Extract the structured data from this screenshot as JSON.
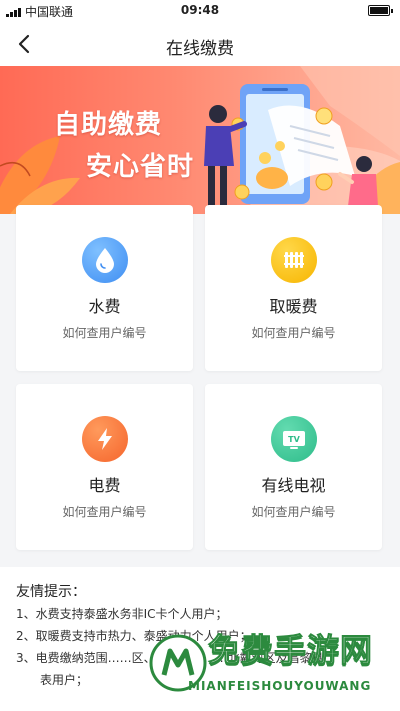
{
  "status_bar": {
    "carrier": "中国联通",
    "time": "09:48"
  },
  "nav": {
    "title": "在线缴费"
  },
  "banner": {
    "line1": "自助缴费",
    "line2": "安心省时"
  },
  "cards": [
    {
      "title": "水费",
      "subtitle": "如何查用户编号",
      "icon": "water-drop-icon",
      "color": "#3f8ef2"
    },
    {
      "title": "取暖费",
      "subtitle": "如何查用户编号",
      "icon": "heater-icon",
      "color": "#f7b500"
    },
    {
      "title": "电费",
      "subtitle": "如何查用户编号",
      "icon": "lightning-icon",
      "color": "#f5652c"
    },
    {
      "title": "有线电视",
      "subtitle": "如何查用户编号",
      "icon": "tv-icon",
      "color": "#2ebc8a"
    }
  ],
  "tips": {
    "title": "友情提示：",
    "items": [
      {
        "num": "1、",
        "text": "水费支持泰盛水务非IC卡个人用户；"
      },
      {
        "num": "2、",
        "text": "取暖费支持市热力、泰盛动力个人用户；"
      },
      {
        "num": "3、",
        "text": "电费缴纳范围……区、……区、……北戴河区及昌黎县"
      },
      {
        "num": "",
        "text": "表用户；"
      }
    ]
  },
  "watermark": {
    "main": "免费手游网",
    "sub": "MIANFEISHOUYOUWANG"
  }
}
